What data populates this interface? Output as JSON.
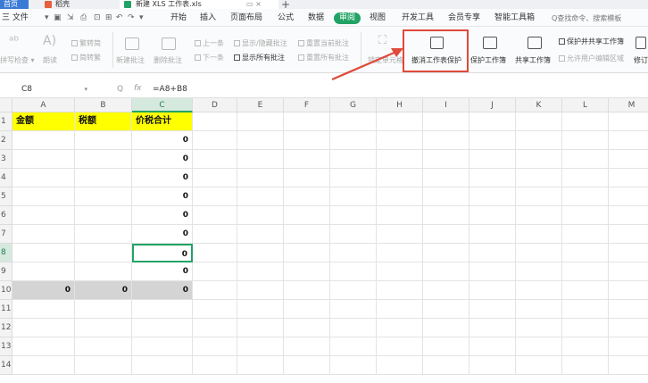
{
  "tabs": {
    "home": "首页",
    "doc": "稻壳",
    "xls": "新建 XLS 工作表.xls",
    "close": "×",
    "add": "+"
  },
  "menu": {
    "file": "三 文件",
    "items": [
      "开始",
      "插入",
      "页面布局",
      "公式",
      "数据",
      "审阅",
      "视图",
      "开发工具",
      "会员专享",
      "智能工具箱"
    ],
    "active_index": 5,
    "search_placeholder": "Q查找命令、搜索模板"
  },
  "ribbon": {
    "spellcheck": "拼写检查 ▾",
    "read_aloud": "朗读",
    "simp": "繁转简",
    "trad": "简转繁",
    "new_comment": "新建批注",
    "delete_comment": "删除批注",
    "prev": "上一条",
    "next": "下一条",
    "show_hide_comment": "显示/隐藏批注",
    "show_all_comments": "显示所有批注",
    "reset_current_comment": "重置当前批注",
    "reset_all_comments": "重置所有批注",
    "lock_cells": "锁定单元格",
    "unprotect_sheet": "撤消工作表保护",
    "protect_workbook": "保护工作簿",
    "share_workbook": "共享工作簿",
    "protect_shared": "保护并共享工作簿",
    "allow_edit": "允许用户编辑区域",
    "track": "修订"
  },
  "formula_bar": {
    "cell_ref": "C8",
    "caret": "▾",
    "formula": "=A8+B8",
    "fx": "fx",
    "zoom_icon": "Q"
  },
  "sheet": {
    "columns": [
      "A",
      "B",
      "C",
      "D",
      "E",
      "F",
      "G",
      "H",
      "I",
      "J",
      "K",
      "L",
      "M"
    ],
    "selected_column": "C",
    "rows": [
      "1",
      "2",
      "3",
      "4",
      "5",
      "6",
      "7",
      "8",
      "9",
      "10",
      "11",
      "12",
      "13",
      "14"
    ],
    "selected_row": "8",
    "header": {
      "A": "金额",
      "B": "税额",
      "C": "价税合计"
    },
    "c_values": [
      "0",
      "0",
      "0",
      "0",
      "0",
      "0",
      "0",
      "0"
    ],
    "totals": {
      "A": "0",
      "B": "0",
      "C": "0"
    }
  },
  "colors": {
    "accent": "#21a366",
    "header_fill": "#ffff00",
    "total_fill": "#d4d4d4",
    "highlight": "#e04a3a"
  }
}
